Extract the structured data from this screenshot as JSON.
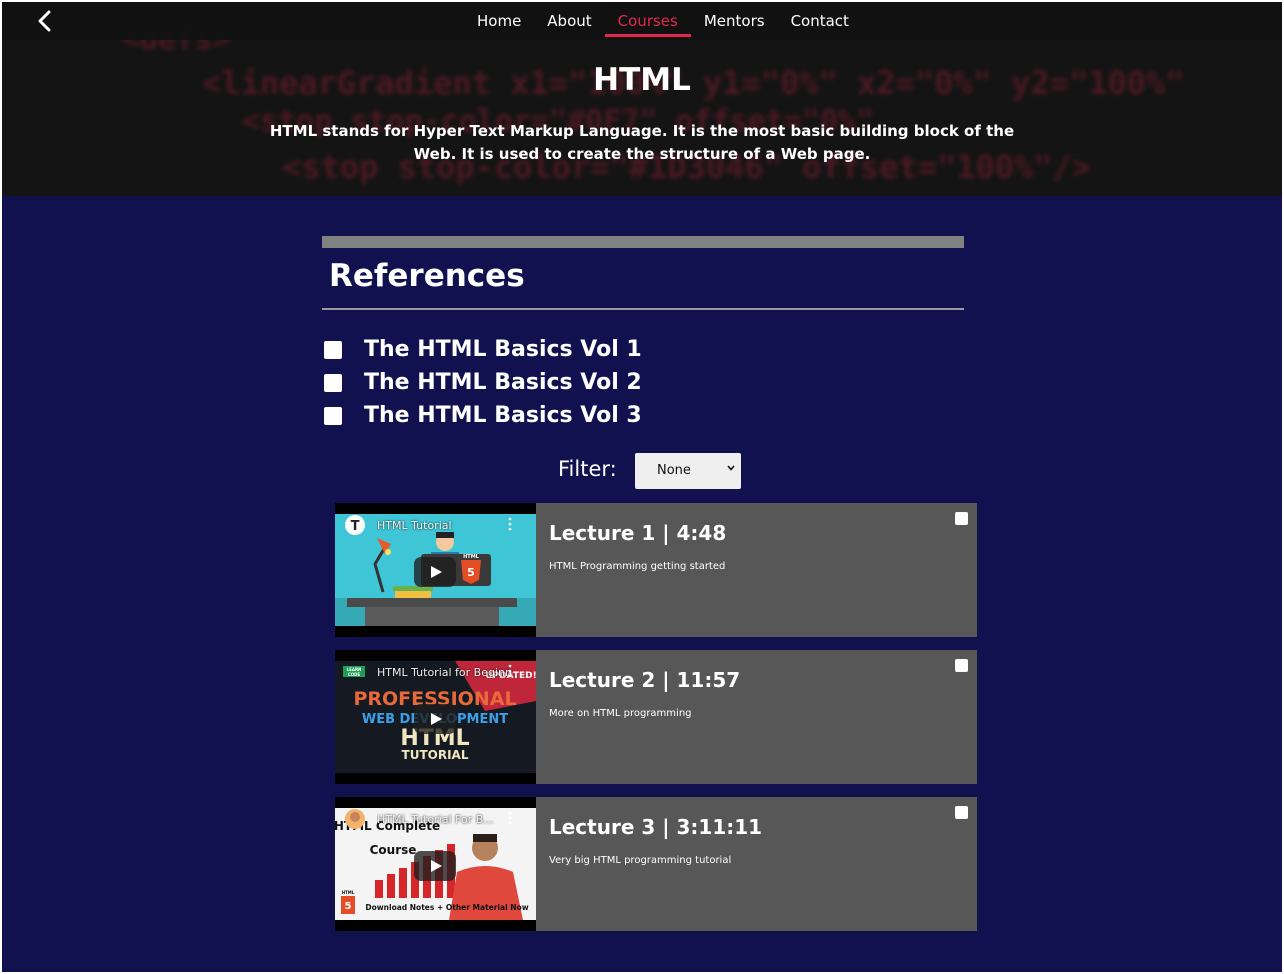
{
  "nav": {
    "items": [
      {
        "label": "Home"
      },
      {
        "label": "About"
      },
      {
        "label": "Courses",
        "active": true
      },
      {
        "label": "Mentors"
      },
      {
        "label": "Contact"
      }
    ]
  },
  "hero": {
    "title": "HTML",
    "description": "HTML stands for Hyper Text Markup Language. It is the most basic building block of the Web. It is used to create the structure of a Web page.",
    "background_code": [
      "<defs>",
      "<linearGradient x1=\"100%\" y1=\"0%\" x2=\"0%\" y2=\"100%\"",
      "<stop stop-color=\"#0F7\" offset=\"0%\"",
      "<stop stop-color=\"#1D3046\" offset=\"100%\"/>"
    ]
  },
  "references": {
    "heading": "References",
    "items": [
      {
        "label": "The HTML Basics Vol 1"
      },
      {
        "label": "The HTML Basics Vol 2"
      },
      {
        "label": "The HTML Basics Vol 3"
      }
    ]
  },
  "filter": {
    "label": "Filter:",
    "selected": "None"
  },
  "lectures": [
    {
      "title": "Lecture 1 | 4:48",
      "description": "HTML Programming getting started",
      "video_title": "HTML Tutorial"
    },
    {
      "title": "Lecture 2 | 11:57",
      "description": "More on HTML programming",
      "video_title": "HTML Tutorial for Beginners"
    },
    {
      "title": "Lecture 3 | 3:11:11",
      "description": "Very big HTML programming tutorial",
      "video_title": "HTML Tutorial For B..."
    }
  ],
  "thumbnail_text": {
    "lecture2": {
      "line1": "PROFESSIONAL",
      "line2": "WEB DEVELOPMENT",
      "line3": "HTML",
      "line4": "TUTORIAL",
      "badge": "UPDATED!",
      "logo_top": "LEARN",
      "logo_bottom": "CODE"
    },
    "lecture3": {
      "line1": "HTML Complete",
      "line2": "Course",
      "line3": "Download Notes + Other Material Now",
      "badge": "HTML"
    },
    "lecture1": {
      "badge": "HTML"
    }
  },
  "colors": {
    "page_bg": "#111150",
    "accent": "#e4284d",
    "card_bg": "#575757",
    "divider": "#818181"
  },
  "icons": {
    "back": "chevron-left-icon",
    "play": "play-icon",
    "menu": "more-vert-icon"
  }
}
